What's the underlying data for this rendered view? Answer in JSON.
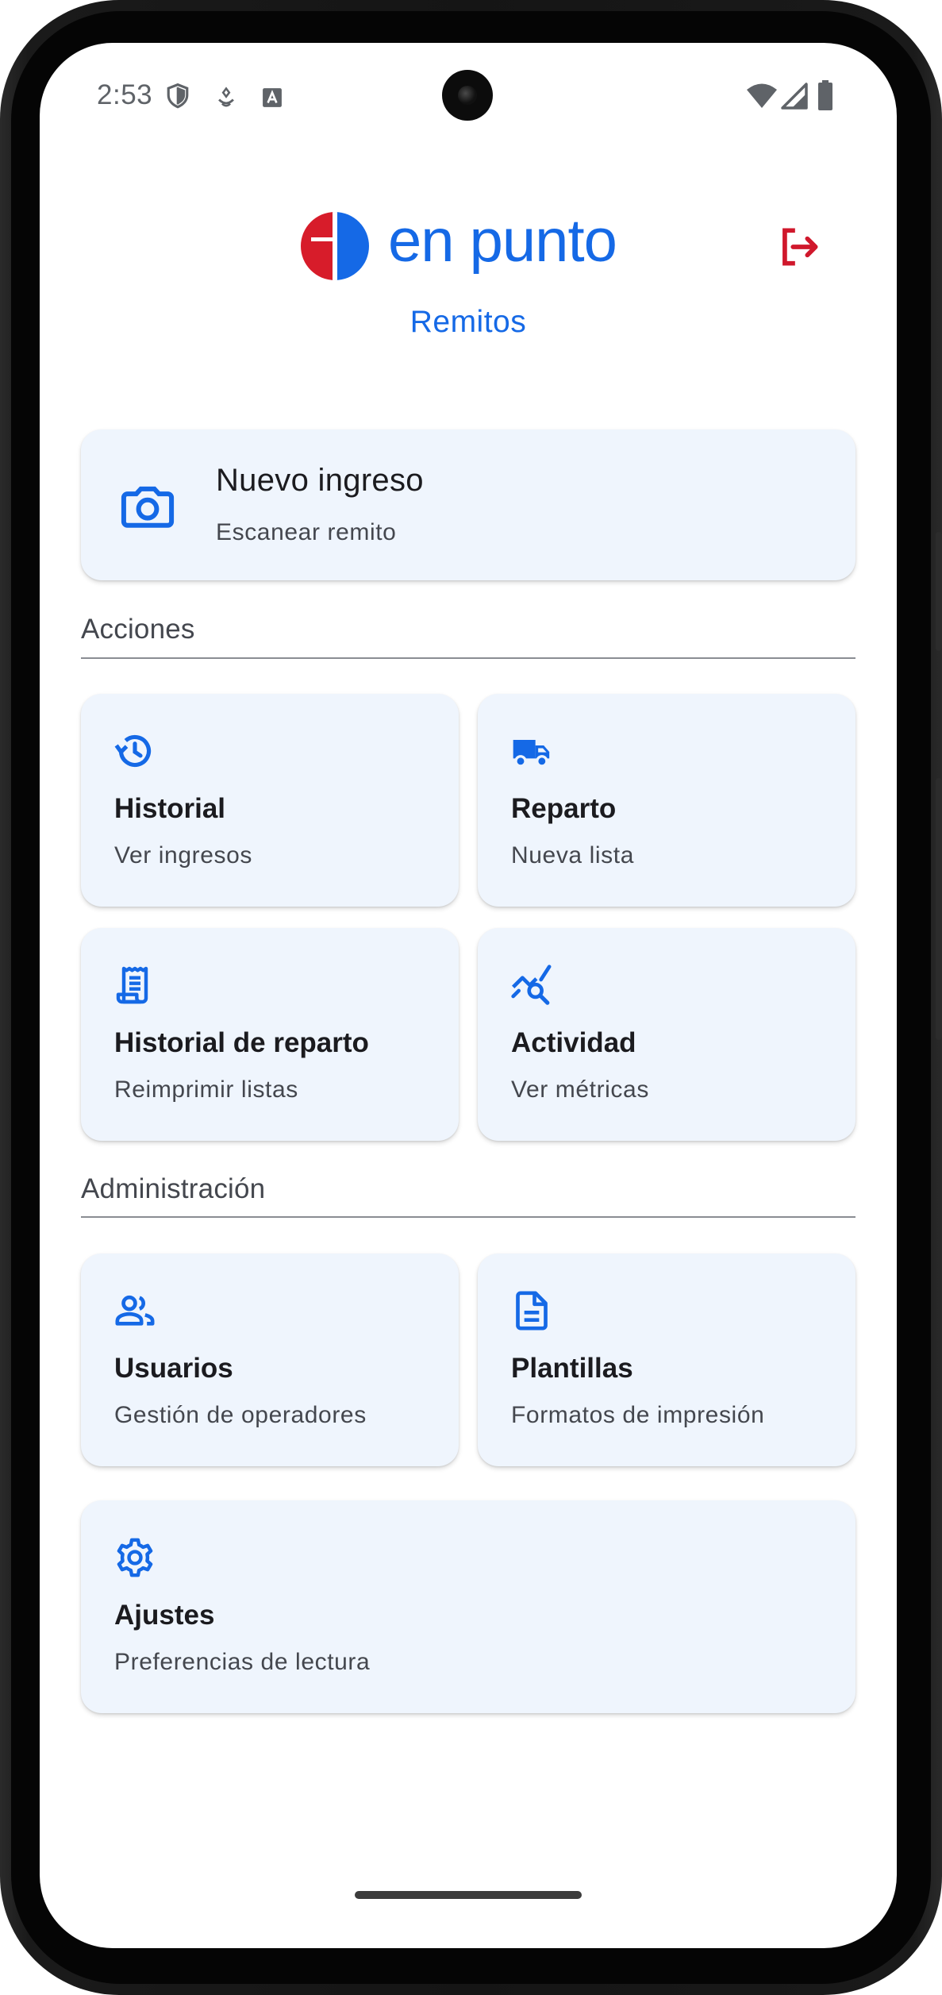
{
  "status_bar": {
    "time": "2:53",
    "left_icons": [
      "shield-icon",
      "location-icon",
      "font-icon"
    ],
    "right_icons": [
      "wifi-icon",
      "signal-icon",
      "battery-icon"
    ]
  },
  "header": {
    "brand": "en punto",
    "subtitle": "Remitos",
    "logout_icon": "logout-icon"
  },
  "colors": {
    "accent": "#1569e6",
    "logout_red": "#d0182c",
    "card_bg": "#eff5fd",
    "logo_red": "#d71c2a"
  },
  "primary_action": {
    "title": "Nuevo ingreso",
    "subtitle": "Escanear remito",
    "icon": "camera-icon"
  },
  "sections": {
    "acciones": {
      "label": "Acciones",
      "items": [
        {
          "title": "Historial",
          "subtitle": "Ver ingresos",
          "icon": "history-icon"
        },
        {
          "title": "Reparto",
          "subtitle": "Nueva lista",
          "icon": "truck-icon"
        },
        {
          "title": "Historial de reparto",
          "subtitle": "Reimprimir listas",
          "icon": "receipt-icon"
        },
        {
          "title": "Actividad",
          "subtitle": "Ver métricas",
          "icon": "query-stats-icon"
        }
      ]
    },
    "administracion": {
      "label": "Administración",
      "items": [
        {
          "title": "Usuarios",
          "subtitle": "Gestión de operadores",
          "icon": "group-icon"
        },
        {
          "title": "Plantillas",
          "subtitle": "Formatos de impresión",
          "icon": "document-icon"
        },
        {
          "title": "Ajustes",
          "subtitle": "Preferencias de lectura",
          "icon": "settings-icon"
        }
      ]
    }
  }
}
